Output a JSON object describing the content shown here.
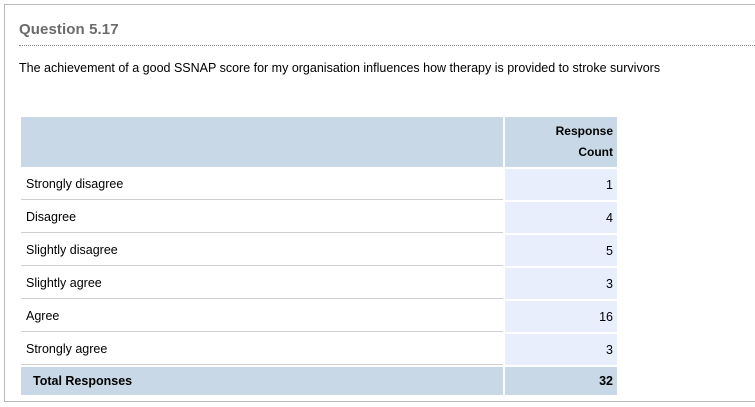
{
  "question": {
    "title": "Question 5.17",
    "text": "The achievement of a good SSNAP score for my organisation influences how therapy is provided to stroke survivors"
  },
  "table": {
    "header": {
      "label": "",
      "count_line1": "Response",
      "count_line2": "Count"
    },
    "rows": [
      {
        "label": "Strongly disagree",
        "count": "1"
      },
      {
        "label": "Disagree",
        "count": "4"
      },
      {
        "label": "Slightly disagree",
        "count": "5"
      },
      {
        "label": "Slightly agree",
        "count": "3"
      },
      {
        "label": "Agree",
        "count": "16"
      },
      {
        "label": "Strongly agree",
        "count": "3"
      }
    ],
    "total": {
      "label": "Total Responses",
      "count": "32"
    }
  },
  "colors": {
    "header_bg": "#c9d8e6",
    "count_cell_bg": "#e8eefc",
    "title_color": "#6b6b6b"
  }
}
